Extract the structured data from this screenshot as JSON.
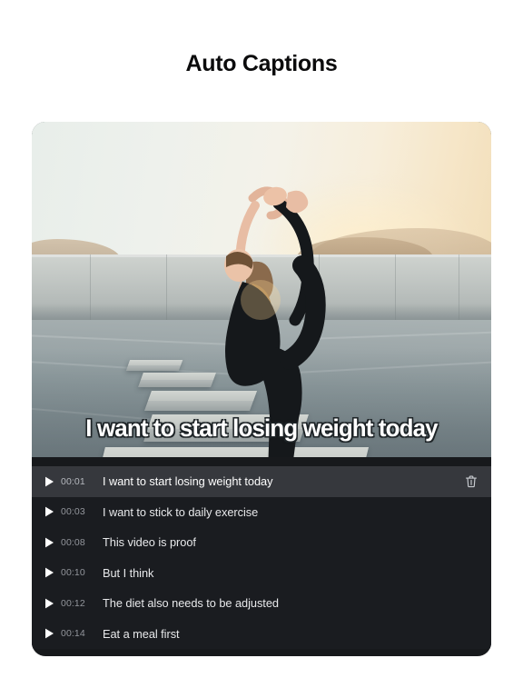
{
  "page": {
    "title": "Auto Captions",
    "background_color": "#ffffff",
    "title_color": "#0b0b0c"
  },
  "video": {
    "overlay_caption": "I want to start losing weight today",
    "scene_description": "woman in black activewear doing a standing bow yoga pose on concrete blocks at sunset",
    "caption_text_color": "#ffffff",
    "caption_stroke_color": "#1d2326"
  },
  "caption_list": {
    "panel_color": "#17191c",
    "row_color": "#1a1c20",
    "active_row_color": "#36383d",
    "play_icon": "play-icon",
    "delete_icon": "trash-icon",
    "rows": [
      {
        "time": "00:01",
        "text": "I want to start losing weight today",
        "active": true
      },
      {
        "time": "00:03",
        "text": "I want to stick to daily exercise",
        "active": false
      },
      {
        "time": "00:08",
        "text": "This video is proof",
        "active": false
      },
      {
        "time": "00:10",
        "text": "But I think",
        "active": false
      },
      {
        "time": "00:12",
        "text": "The diet also needs to be adjusted",
        "active": false
      },
      {
        "time": "00:14",
        "text": "Eat a meal first",
        "active": false
      }
    ]
  }
}
